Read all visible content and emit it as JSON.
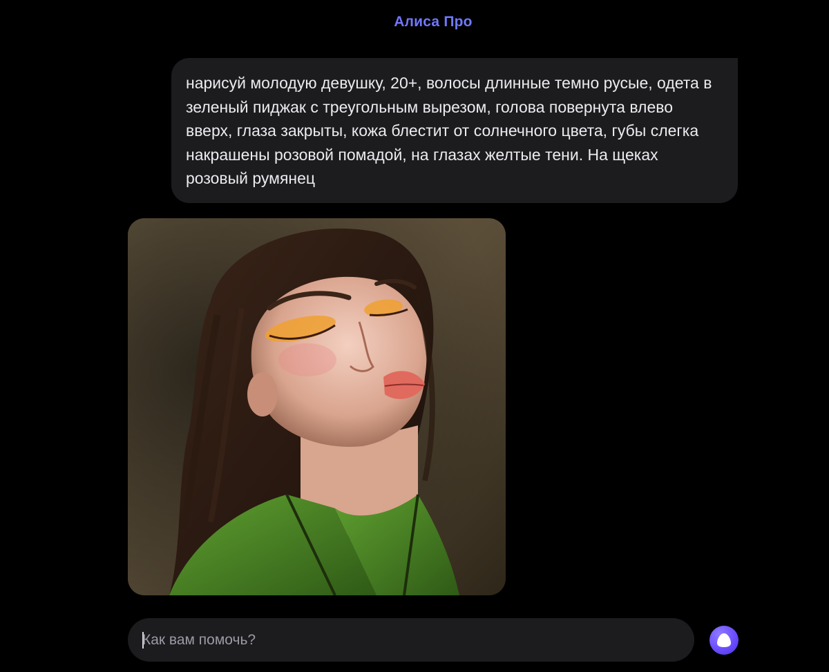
{
  "header": {
    "title": "Алиса Про"
  },
  "conversation": {
    "user_message": "нарисуй молодую девушку, 20+, волосы длинные темно русые, одета в зеленый пиджак с треугольным вырезом, голова повернута влево вверх, глаза закрыты, кожа блестит от солнечного цвета, губы слегка накрашены розовой помадой, на глазах желтые тени. На щеках розовый румянец"
  },
  "composer": {
    "placeholder": "Как вам помочь?",
    "value": ""
  },
  "icons": {
    "assistant": "alice-icon"
  },
  "colors": {
    "background": "#000000",
    "bubble": "#1c1c1f",
    "accent": "#6a4dff"
  }
}
